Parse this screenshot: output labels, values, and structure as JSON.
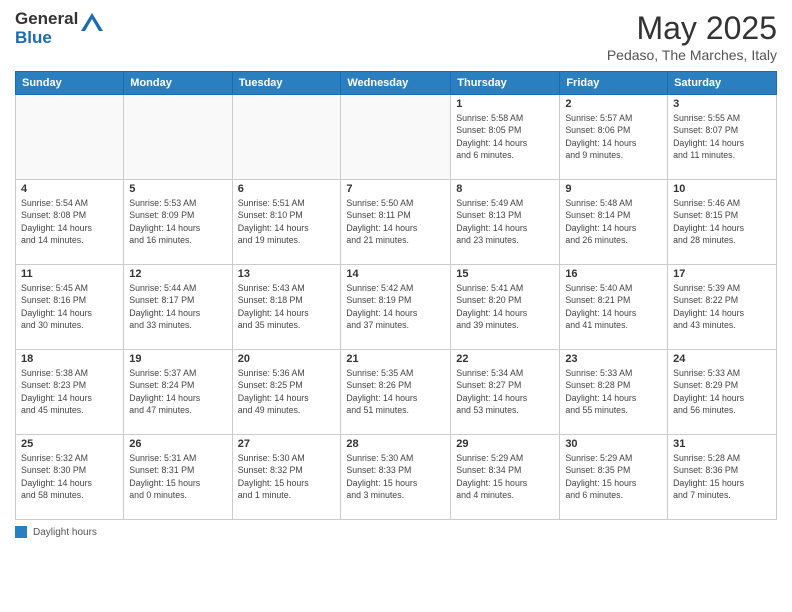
{
  "header": {
    "logo_general": "General",
    "logo_blue": "Blue",
    "month_title": "May 2025",
    "subtitle": "Pedaso, The Marches, Italy"
  },
  "weekdays": [
    "Sunday",
    "Monday",
    "Tuesday",
    "Wednesday",
    "Thursday",
    "Friday",
    "Saturday"
  ],
  "footer": {
    "label": "Daylight hours"
  },
  "weeks": [
    [
      {
        "day": "",
        "info": ""
      },
      {
        "day": "",
        "info": ""
      },
      {
        "day": "",
        "info": ""
      },
      {
        "day": "",
        "info": ""
      },
      {
        "day": "1",
        "info": "Sunrise: 5:58 AM\nSunset: 8:05 PM\nDaylight: 14 hours\nand 6 minutes."
      },
      {
        "day": "2",
        "info": "Sunrise: 5:57 AM\nSunset: 8:06 PM\nDaylight: 14 hours\nand 9 minutes."
      },
      {
        "day": "3",
        "info": "Sunrise: 5:55 AM\nSunset: 8:07 PM\nDaylight: 14 hours\nand 11 minutes."
      }
    ],
    [
      {
        "day": "4",
        "info": "Sunrise: 5:54 AM\nSunset: 8:08 PM\nDaylight: 14 hours\nand 14 minutes."
      },
      {
        "day": "5",
        "info": "Sunrise: 5:53 AM\nSunset: 8:09 PM\nDaylight: 14 hours\nand 16 minutes."
      },
      {
        "day": "6",
        "info": "Sunrise: 5:51 AM\nSunset: 8:10 PM\nDaylight: 14 hours\nand 19 minutes."
      },
      {
        "day": "7",
        "info": "Sunrise: 5:50 AM\nSunset: 8:11 PM\nDaylight: 14 hours\nand 21 minutes."
      },
      {
        "day": "8",
        "info": "Sunrise: 5:49 AM\nSunset: 8:13 PM\nDaylight: 14 hours\nand 23 minutes."
      },
      {
        "day": "9",
        "info": "Sunrise: 5:48 AM\nSunset: 8:14 PM\nDaylight: 14 hours\nand 26 minutes."
      },
      {
        "day": "10",
        "info": "Sunrise: 5:46 AM\nSunset: 8:15 PM\nDaylight: 14 hours\nand 28 minutes."
      }
    ],
    [
      {
        "day": "11",
        "info": "Sunrise: 5:45 AM\nSunset: 8:16 PM\nDaylight: 14 hours\nand 30 minutes."
      },
      {
        "day": "12",
        "info": "Sunrise: 5:44 AM\nSunset: 8:17 PM\nDaylight: 14 hours\nand 33 minutes."
      },
      {
        "day": "13",
        "info": "Sunrise: 5:43 AM\nSunset: 8:18 PM\nDaylight: 14 hours\nand 35 minutes."
      },
      {
        "day": "14",
        "info": "Sunrise: 5:42 AM\nSunset: 8:19 PM\nDaylight: 14 hours\nand 37 minutes."
      },
      {
        "day": "15",
        "info": "Sunrise: 5:41 AM\nSunset: 8:20 PM\nDaylight: 14 hours\nand 39 minutes."
      },
      {
        "day": "16",
        "info": "Sunrise: 5:40 AM\nSunset: 8:21 PM\nDaylight: 14 hours\nand 41 minutes."
      },
      {
        "day": "17",
        "info": "Sunrise: 5:39 AM\nSunset: 8:22 PM\nDaylight: 14 hours\nand 43 minutes."
      }
    ],
    [
      {
        "day": "18",
        "info": "Sunrise: 5:38 AM\nSunset: 8:23 PM\nDaylight: 14 hours\nand 45 minutes."
      },
      {
        "day": "19",
        "info": "Sunrise: 5:37 AM\nSunset: 8:24 PM\nDaylight: 14 hours\nand 47 minutes."
      },
      {
        "day": "20",
        "info": "Sunrise: 5:36 AM\nSunset: 8:25 PM\nDaylight: 14 hours\nand 49 minutes."
      },
      {
        "day": "21",
        "info": "Sunrise: 5:35 AM\nSunset: 8:26 PM\nDaylight: 14 hours\nand 51 minutes."
      },
      {
        "day": "22",
        "info": "Sunrise: 5:34 AM\nSunset: 8:27 PM\nDaylight: 14 hours\nand 53 minutes."
      },
      {
        "day": "23",
        "info": "Sunrise: 5:33 AM\nSunset: 8:28 PM\nDaylight: 14 hours\nand 55 minutes."
      },
      {
        "day": "24",
        "info": "Sunrise: 5:33 AM\nSunset: 8:29 PM\nDaylight: 14 hours\nand 56 minutes."
      }
    ],
    [
      {
        "day": "25",
        "info": "Sunrise: 5:32 AM\nSunset: 8:30 PM\nDaylight: 14 hours\nand 58 minutes."
      },
      {
        "day": "26",
        "info": "Sunrise: 5:31 AM\nSunset: 8:31 PM\nDaylight: 15 hours\nand 0 minutes."
      },
      {
        "day": "27",
        "info": "Sunrise: 5:30 AM\nSunset: 8:32 PM\nDaylight: 15 hours\nand 1 minute."
      },
      {
        "day": "28",
        "info": "Sunrise: 5:30 AM\nSunset: 8:33 PM\nDaylight: 15 hours\nand 3 minutes."
      },
      {
        "day": "29",
        "info": "Sunrise: 5:29 AM\nSunset: 8:34 PM\nDaylight: 15 hours\nand 4 minutes."
      },
      {
        "day": "30",
        "info": "Sunrise: 5:29 AM\nSunset: 8:35 PM\nDaylight: 15 hours\nand 6 minutes."
      },
      {
        "day": "31",
        "info": "Sunrise: 5:28 AM\nSunset: 8:36 PM\nDaylight: 15 hours\nand 7 minutes."
      }
    ]
  ]
}
